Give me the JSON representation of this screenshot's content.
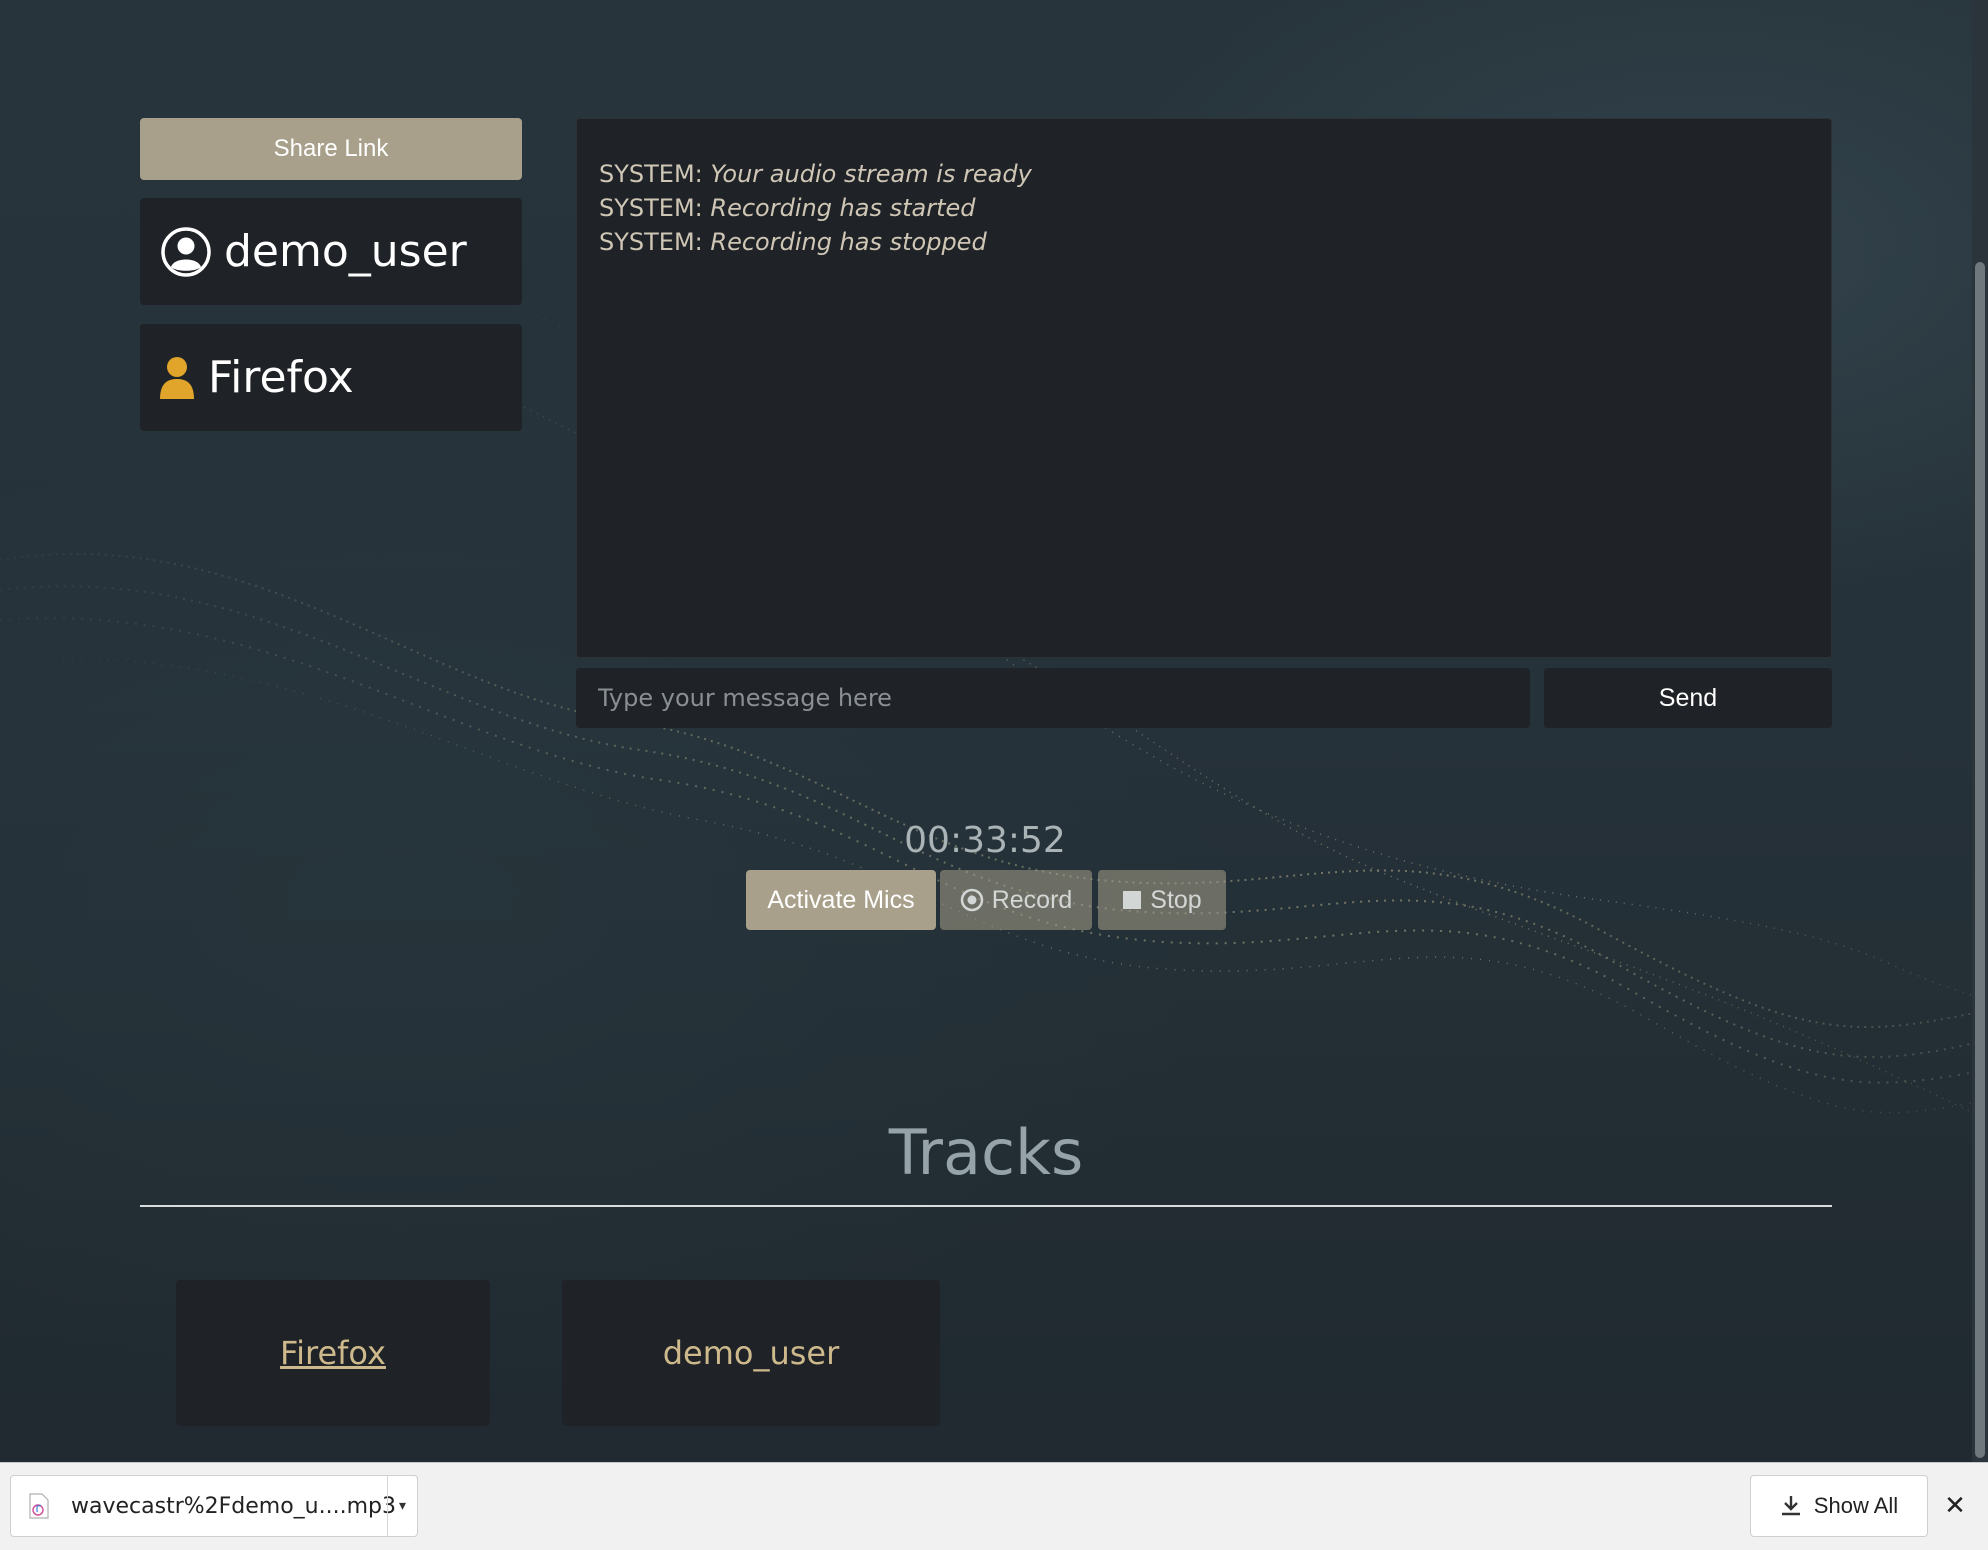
{
  "sidebar": {
    "share_label": "Share Link",
    "current_user": "demo_user",
    "peer_user": "Firefox"
  },
  "chat": {
    "messages": [
      {
        "sender": "SYSTEM:",
        "text": "Your audio stream is ready"
      },
      {
        "sender": "SYSTEM:",
        "text": "Recording has started"
      },
      {
        "sender": "SYSTEM:",
        "text": "Recording has stopped"
      }
    ],
    "input_placeholder": "Type your message here",
    "send_label": "Send"
  },
  "controls": {
    "timer": "00:33:52",
    "activate_label": "Activate Mics",
    "record_label": "Record",
    "stop_label": "Stop"
  },
  "tracks": {
    "title": "Tracks",
    "items": [
      {
        "label": "Firefox"
      },
      {
        "label": "demo_user"
      }
    ]
  },
  "download_bar": {
    "file_name": "wavecastr%2Fdemo_u....mp3",
    "show_all_label": "Show All"
  },
  "colors": {
    "accent": "#a8a08a",
    "panel": "#1f2327",
    "peer_icon": "#e0a52a",
    "track_text": "#cdb98b"
  },
  "icons": {
    "current_user": "user-circle-icon",
    "peer_user": "user-icon",
    "record": "record-circle-icon",
    "stop": "stop-square-icon",
    "file": "audio-file-icon",
    "show_all": "download-icon",
    "close": "close-icon"
  }
}
